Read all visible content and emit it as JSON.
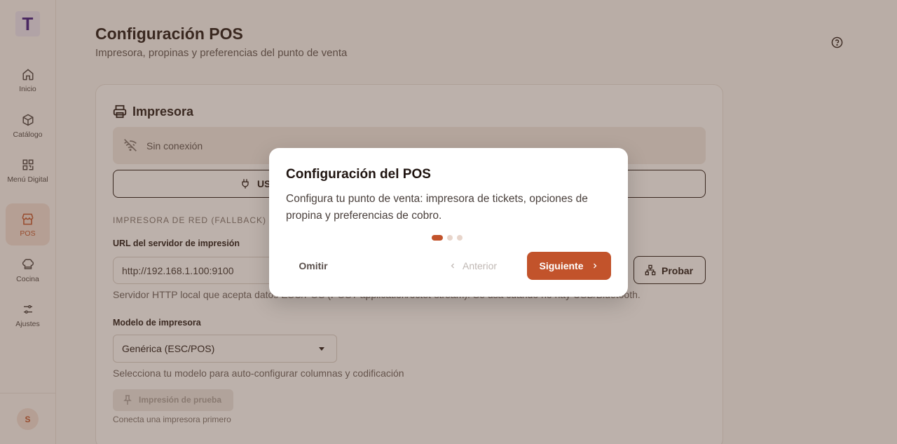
{
  "sidebar": {
    "logo": "T",
    "items": [
      {
        "label": "Inicio",
        "icon": "home-icon"
      },
      {
        "label": "Catálogo",
        "icon": "box-icon"
      },
      {
        "label": "Menú Digital",
        "icon": "qr-code-icon"
      },
      {
        "label": "POS",
        "icon": "store-icon",
        "active": true
      },
      {
        "label": "Cocina",
        "icon": "chef-hat-icon"
      },
      {
        "label": "Ajustes",
        "icon": "sliders-icon"
      }
    ],
    "avatar": "S"
  },
  "header": {
    "title": "Configuración POS",
    "subtitle": "Impresora, propinas y preferencias del punto de venta"
  },
  "printer": {
    "title": "Impresora",
    "status": "Sin conexión",
    "usb_label": "US",
    "section_label": "IMPRESORA DE RED (FALLBACK)",
    "url_label": "URL del servidor de impresión",
    "url_value": "http://192.168.1.100:9100",
    "probar_label": "Probar",
    "url_help": "Servidor HTTP local que acepta datos ESC/POS (POST application/octet-stream). Se usa cuando no hay USB/Bluetooth.",
    "model_label": "Modelo de impresora",
    "model_value": "Genérica (ESC/POS)",
    "model_help": "Selecciona tu modelo para auto-configurar columnas y codificación",
    "test_label": "Impresión de prueba",
    "test_help": "Conecta una impresora primero"
  },
  "modal": {
    "title": "Configuración del POS",
    "body": "Configura tu punto de venta: impresora de tickets, opciones de propina y preferencias de cobro.",
    "steps_total": 3,
    "step_current": 1,
    "skip_label": "Omitir",
    "prev_label": "Anterior",
    "next_label": "Siguiente"
  },
  "colors": {
    "accent": "#c2532b",
    "overlay": "#5f4637"
  }
}
